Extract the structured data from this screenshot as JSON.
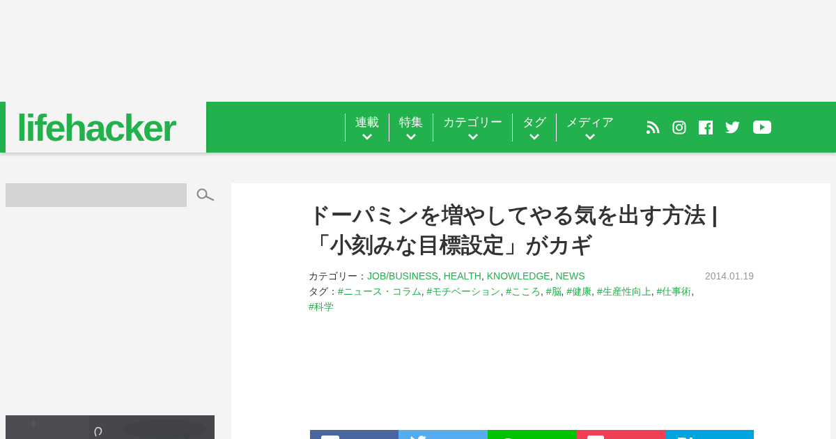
{
  "logo": {
    "text": "lifehacker"
  },
  "nav": [
    {
      "label": "連載"
    },
    {
      "label": "特集"
    },
    {
      "label": "カテゴリー"
    },
    {
      "label": "タグ"
    },
    {
      "label": "メディア"
    }
  ],
  "social": [
    {
      "kind": "rss"
    },
    {
      "kind": "instagram"
    },
    {
      "kind": "facebook"
    },
    {
      "kind": "twitter"
    },
    {
      "kind": "youtube"
    }
  ],
  "article": {
    "title": "ドーパミンを増やしてやる気を出す方法 | 「小刻みな目標設定」がカギ",
    "date": "2014.01.19",
    "category_label": "カテゴリー：",
    "categories": [
      "JOB/BUSINESS",
      "HEALTH",
      "KNOWLEDGE",
      "NEWS"
    ],
    "tag_label": "タグ：",
    "tags": [
      "#ニュース・コラム",
      "#モチベーション",
      "#こころ",
      "#脳",
      "#健康",
      "#生産性向上",
      "#仕事術",
      "#科学"
    ],
    "separator": ", ",
    "share": [
      {
        "kind": "facebook",
        "color": "#4a66a0"
      },
      {
        "kind": "twitter",
        "color": "#55acee"
      },
      {
        "kind": "line",
        "color": "#00c300"
      },
      {
        "kind": "pocket",
        "color": "#ef4056"
      },
      {
        "kind": "hatena",
        "color": "#00a4de"
      }
    ]
  }
}
